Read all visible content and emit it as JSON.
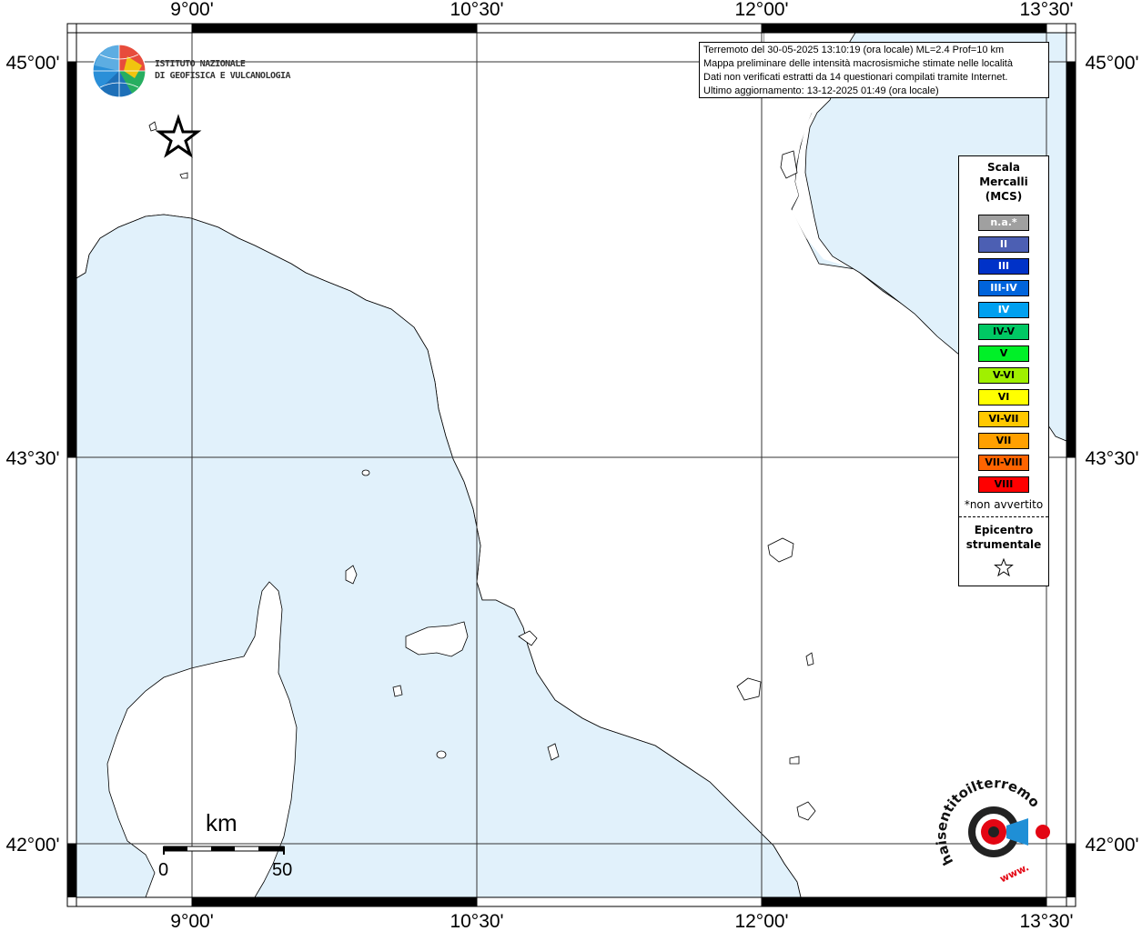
{
  "header": {
    "line1": "Terremoto del 30-05-2025 13:10:19 (ora locale) ML=2.4 Prof=10 km",
    "line2": "Mappa preliminare delle intensità macrosismiche stimate nelle località",
    "line3": "Dati non verificati estratti da 14 questionari compilati tramite Internet.",
    "line4": "Ultimo aggiornamento: 13-12-2025 01:49 (ora locale)"
  },
  "axes": {
    "longitude_labels": [
      "9°00'",
      "10°30'",
      "12°00'",
      "13°30'"
    ],
    "latitude_labels": [
      "45°00'",
      "43°30'",
      "42°00'"
    ]
  },
  "logo_ingv": {
    "line1": "ISTITUTO NAZIONALE",
    "line2": "DI GEOFISICA E VULCANOLOGIA"
  },
  "logo_hsit": {
    "text": "haisentitoilterremoto.it",
    "url_text": "www."
  },
  "legend": {
    "title_line1": "Scala",
    "title_line2": "Mercalli",
    "title_line3": "(MCS)",
    "items": [
      {
        "label": "n.a.*",
        "color": "#a0a0a0",
        "text": "#ffffff"
      },
      {
        "label": "II",
        "color": "#4c5fb3",
        "text": "#ffffff"
      },
      {
        "label": "III",
        "color": "#0032c8",
        "text": "#ffffff"
      },
      {
        "label": "III-IV",
        "color": "#0064dc",
        "text": "#ffffff"
      },
      {
        "label": "IV",
        "color": "#00a0f0",
        "text": "#ffffff"
      },
      {
        "label": "IV-V",
        "color": "#00c864",
        "text": "#000000"
      },
      {
        "label": "V",
        "color": "#00f028",
        "text": "#000000"
      },
      {
        "label": "V-VI",
        "color": "#a0f000",
        "text": "#000000"
      },
      {
        "label": "VI",
        "color": "#ffff00",
        "text": "#000000"
      },
      {
        "label": "VI-VII",
        "color": "#ffc800",
        "text": "#000000"
      },
      {
        "label": "VII",
        "color": "#ffa000",
        "text": "#000000"
      },
      {
        "label": "VII-VIII",
        "color": "#ff6400",
        "text": "#000000"
      },
      {
        "label": "VIII",
        "color": "#ff0000",
        "text": "#000000"
      }
    ],
    "note": "*non avvertito",
    "epicenter_line1": "Epicentro",
    "epicenter_line2": "strumentale"
  },
  "scale_bar": {
    "unit": "km",
    "start": "0",
    "end": "50"
  },
  "colors": {
    "sea": "#e1f1fb",
    "land": "#ffffff",
    "frame": "#000000"
  }
}
